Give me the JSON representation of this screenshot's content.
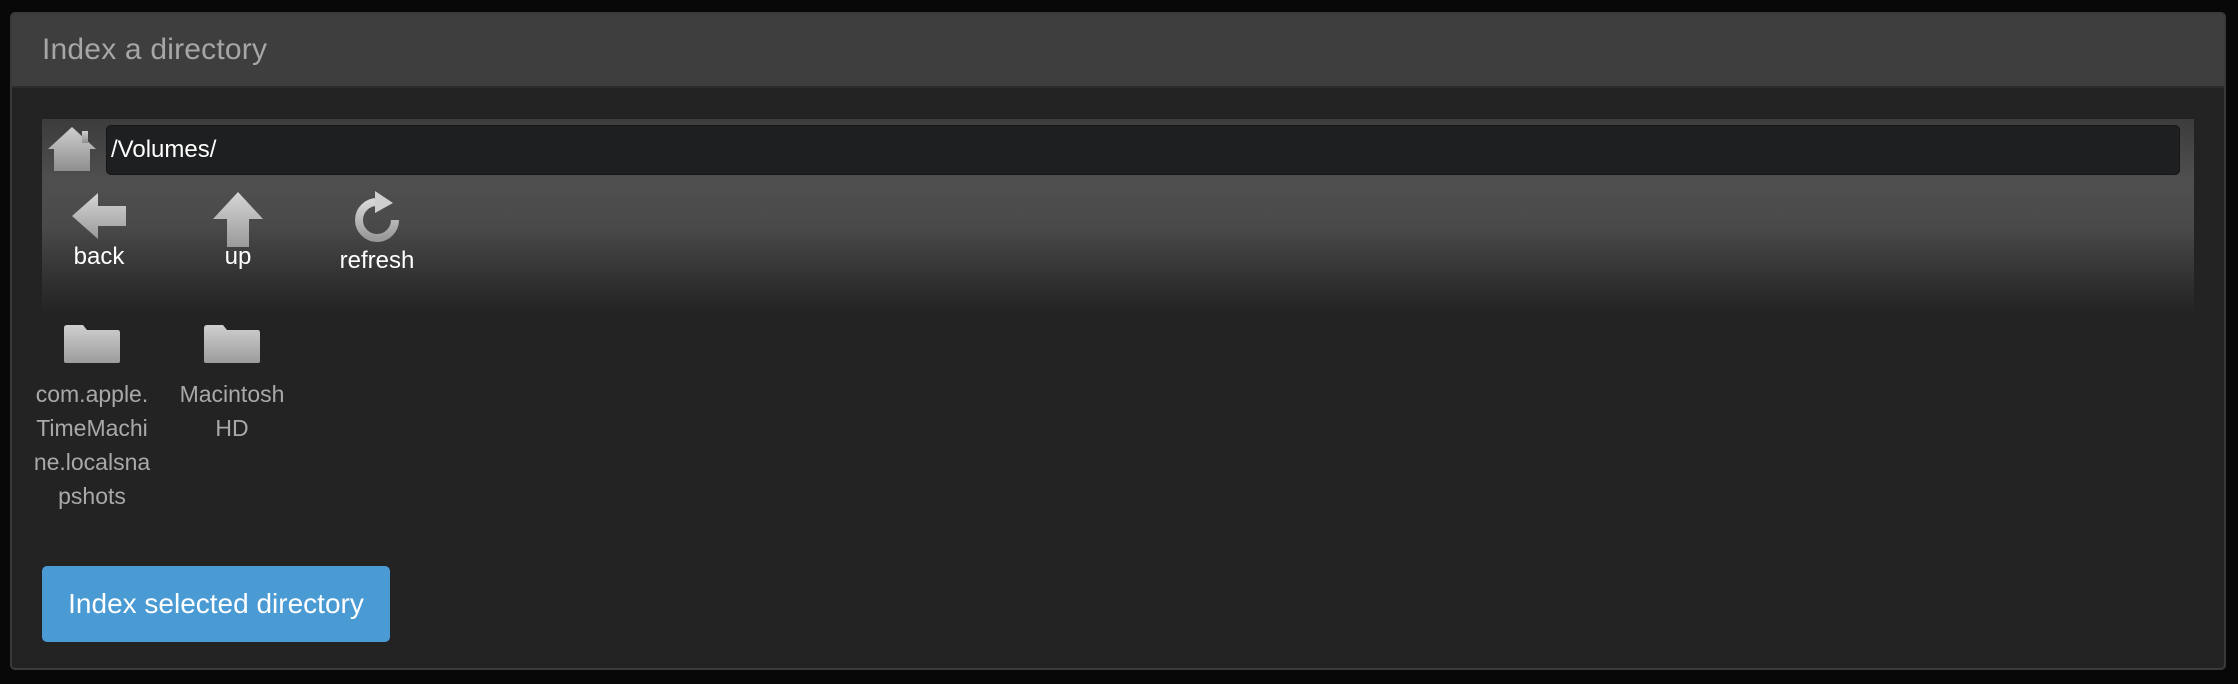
{
  "panel": {
    "title": "Index a directory"
  },
  "browser": {
    "path_value": "/Volumes/",
    "nav": {
      "back_label": "back",
      "up_label": "up",
      "refresh_label": "refresh"
    },
    "items": [
      {
        "name": "com.apple.TimeMachine.localsnapshots",
        "icon": "folder-icon"
      },
      {
        "name": "Macintosh HD",
        "icon": "folder-icon"
      }
    ]
  },
  "actions": {
    "index_label": "Index selected directory"
  },
  "colors": {
    "accent": "#4a9ad3",
    "panel_bg": "#232324",
    "header_bg": "#3e3e3e",
    "icon_gray": "#a8a8a8"
  }
}
